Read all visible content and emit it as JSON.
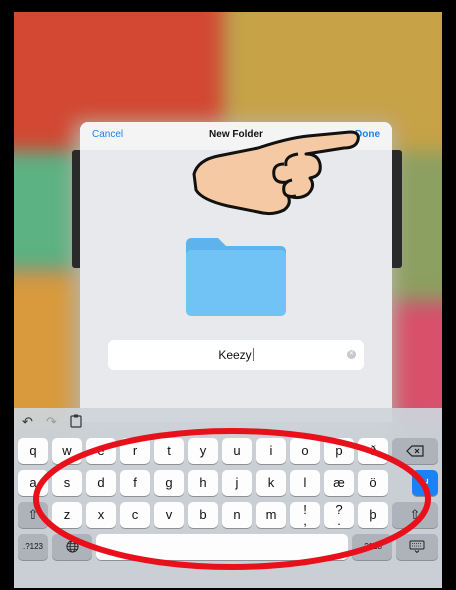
{
  "dialog": {
    "cancel_label": "Cancel",
    "title": "New Folder",
    "done_label": "Done"
  },
  "folder_name": {
    "value": "Keezy"
  },
  "keyboard": {
    "row1": [
      "q",
      "w",
      "e",
      "r",
      "t",
      "y",
      "u",
      "i",
      "o",
      "p",
      "ð"
    ],
    "row2": [
      "a",
      "s",
      "d",
      "f",
      "g",
      "h",
      "j",
      "k",
      "l",
      "æ",
      "ö"
    ],
    "row3": [
      "z",
      "x",
      "c",
      "v",
      "b",
      "n",
      "m",
      "!\n,",
      "?\n.",
      "þ"
    ],
    "numbers_label": ".?123",
    "numbers_label_right": ".?123"
  },
  "colors": {
    "accent": "#1a82f6",
    "annotation": "#e8101a",
    "folder": "#72c3f5"
  },
  "icons": [
    "undo-icon",
    "redo-icon",
    "paste-icon",
    "backspace-icon",
    "return-icon",
    "shift-icon",
    "globe-icon",
    "hide-keyboard-icon",
    "pointing-hand-icon",
    "clear-icon",
    "folder-icon"
  ]
}
